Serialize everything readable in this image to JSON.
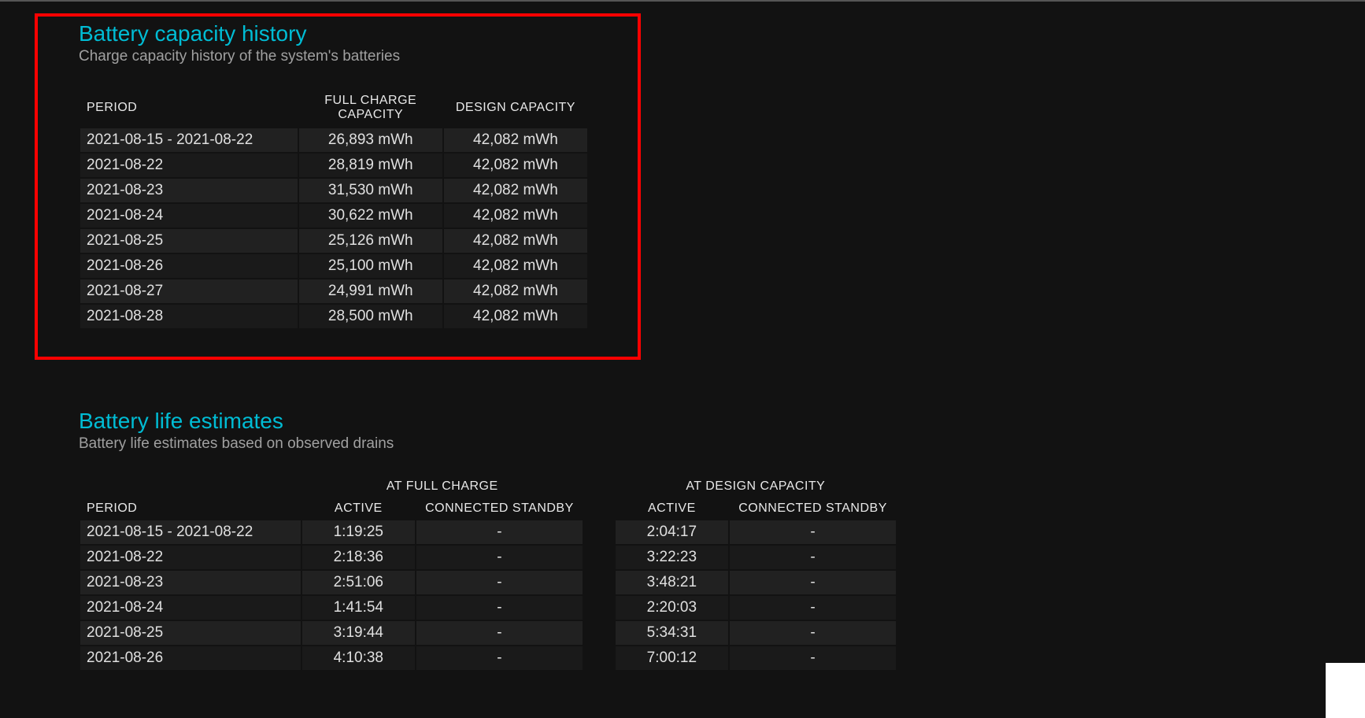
{
  "capacity": {
    "title": "Battery capacity history",
    "subtitle": "Charge capacity history of the system's batteries",
    "columns": {
      "period": "PERIOD",
      "full_charge_l1": "FULL CHARGE",
      "full_charge_l2": "CAPACITY",
      "design": "DESIGN CAPACITY"
    },
    "rows": [
      {
        "period": "2021-08-15 - 2021-08-22",
        "full_charge": "26,893 mWh",
        "design": "42,082 mWh"
      },
      {
        "period": "2021-08-22",
        "full_charge": "28,819 mWh",
        "design": "42,082 mWh"
      },
      {
        "period": "2021-08-23",
        "full_charge": "31,530 mWh",
        "design": "42,082 mWh"
      },
      {
        "period": "2021-08-24",
        "full_charge": "30,622 mWh",
        "design": "42,082 mWh"
      },
      {
        "period": "2021-08-25",
        "full_charge": "25,126 mWh",
        "design": "42,082 mWh"
      },
      {
        "period": "2021-08-26",
        "full_charge": "25,100 mWh",
        "design": "42,082 mWh"
      },
      {
        "period": "2021-08-27",
        "full_charge": "24,991 mWh",
        "design": "42,082 mWh"
      },
      {
        "period": "2021-08-28",
        "full_charge": "28,500 mWh",
        "design": "42,082 mWh"
      }
    ]
  },
  "estimates": {
    "title": "Battery life estimates",
    "subtitle": "Battery life estimates based on observed drains",
    "group_headers": {
      "full": "AT FULL CHARGE",
      "design": "AT DESIGN CAPACITY"
    },
    "columns": {
      "period": "PERIOD",
      "active": "ACTIVE",
      "standby": "CONNECTED STANDBY"
    },
    "rows": [
      {
        "period": "2021-08-15 - 2021-08-22",
        "full_active": "1:19:25",
        "full_standby": "-",
        "design_active": "2:04:17",
        "design_standby": "-"
      },
      {
        "period": "2021-08-22",
        "full_active": "2:18:36",
        "full_standby": "-",
        "design_active": "3:22:23",
        "design_standby": "-"
      },
      {
        "period": "2021-08-23",
        "full_active": "2:51:06",
        "full_standby": "-",
        "design_active": "3:48:21",
        "design_standby": "-"
      },
      {
        "period": "2021-08-24",
        "full_active": "1:41:54",
        "full_standby": "-",
        "design_active": "2:20:03",
        "design_standby": "-"
      },
      {
        "period": "2021-08-25",
        "full_active": "3:19:44",
        "full_standby": "-",
        "design_active": "5:34:31",
        "design_standby": "-"
      },
      {
        "period": "2021-08-26",
        "full_active": "4:10:38",
        "full_standby": "-",
        "design_active": "7:00:12",
        "design_standby": "-"
      }
    ]
  }
}
